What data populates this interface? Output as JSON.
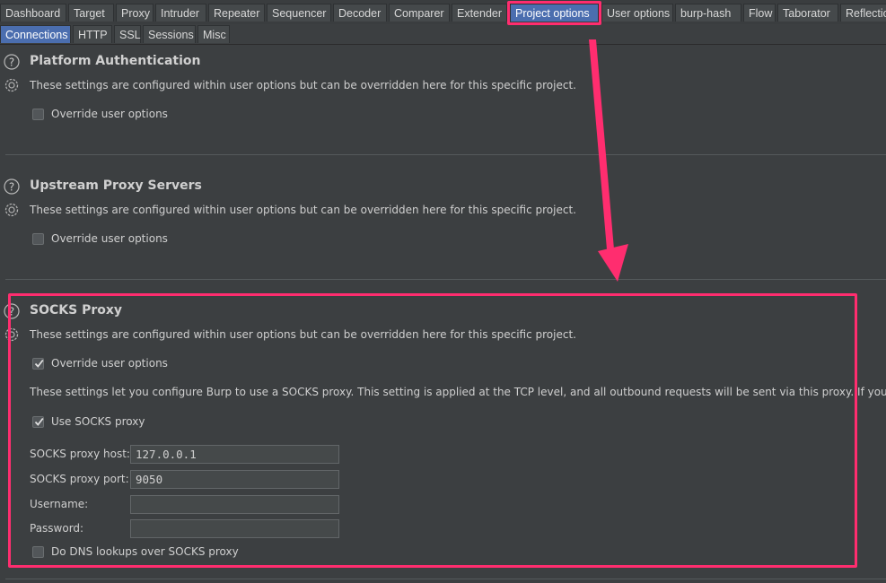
{
  "main_tabs": [
    "Dashboard",
    "Target",
    "Proxy",
    "Intruder",
    "Repeater",
    "Sequencer",
    "Decoder",
    "Comparer",
    "Extender",
    "Project options",
    "User options",
    "burp-hash",
    "Flow",
    "Taborator",
    "Reflectio"
  ],
  "active_main_tab": "Project options",
  "sub_tabs": [
    "Connections",
    "HTTP",
    "SSL",
    "Sessions",
    "Misc"
  ],
  "active_sub_tab": "Connections",
  "sections": {
    "platform_auth": {
      "title": "Platform Authentication",
      "description": "These settings are configured within user options but can be overridden here for this specific project.",
      "override_label": "Override user options",
      "override_checked": false
    },
    "upstream_proxy": {
      "title": "Upstream Proxy Servers",
      "description": "These settings are configured within user options but can be overridden here for this specific project.",
      "override_label": "Override user options",
      "override_checked": false
    },
    "socks_proxy": {
      "title": "SOCKS Proxy",
      "description": "These settings are configured within user options but can be overridden here for this specific project.",
      "override_label": "Override user options",
      "override_checked": true,
      "info": "These settings let you configure Burp to use a SOCKS proxy. This setting is applied at the TCP level, and all outbound requests will be sent via this proxy. If you have",
      "use_socks_label": "Use SOCKS proxy",
      "use_socks_checked": true,
      "host_label": "SOCKS proxy host:",
      "host_value": "127.0.0.1",
      "port_label": "SOCKS proxy port:",
      "port_value": "9050",
      "username_label": "Username:",
      "username_value": "",
      "password_label": "Password:",
      "password_value": "",
      "dns_label": "Do DNS lookups over SOCKS proxy",
      "dns_checked": false
    }
  },
  "colors": {
    "background": "#3c3f41",
    "active_tab": "#4b6eaf",
    "annotation": "#ff2d6f"
  }
}
